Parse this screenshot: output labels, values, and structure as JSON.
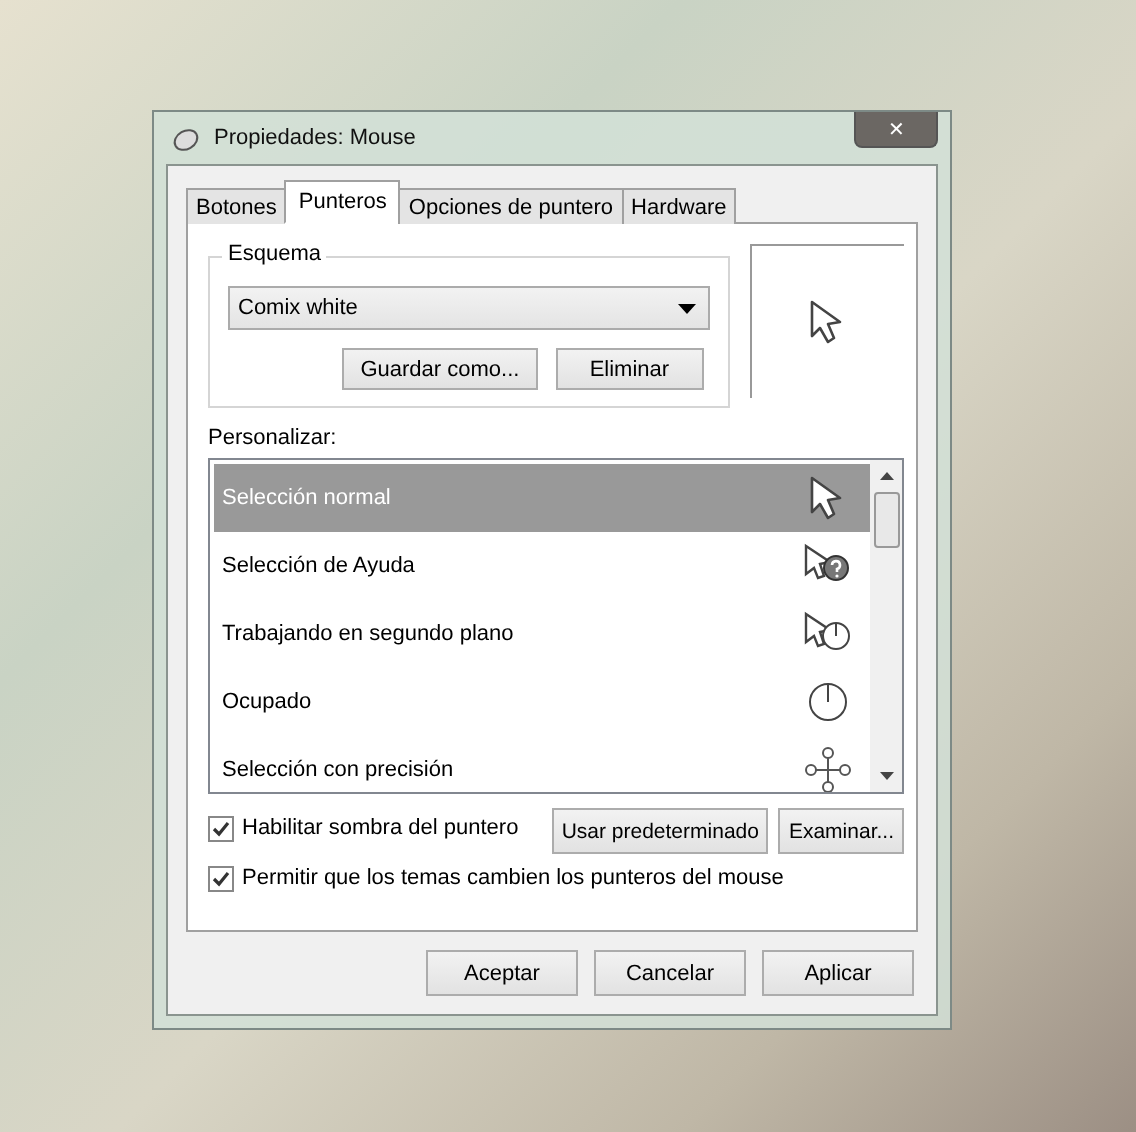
{
  "window": {
    "title": "Propiedades: Mouse",
    "close": "✕"
  },
  "tabs": [
    {
      "label": "Botones",
      "selected": false
    },
    {
      "label": "Punteros",
      "selected": true
    },
    {
      "label": "Opciones de puntero",
      "selected": false
    },
    {
      "label": "Hardware",
      "selected": false
    }
  ],
  "scheme": {
    "legend": "Esquema",
    "value": "Comix white",
    "buttons": [
      "Guardar como...",
      "Eliminar"
    ]
  },
  "customize": {
    "label": "Personalizar:",
    "items": [
      {
        "label": "Selección normal",
        "kind": "arrow",
        "selected": true
      },
      {
        "label": "Selección de Ayuda",
        "kind": "help",
        "selected": false
      },
      {
        "label": "Trabajando en segundo plano",
        "kind": "working",
        "selected": false
      },
      {
        "label": "Ocupado",
        "kind": "busy",
        "selected": false
      },
      {
        "label": "Selección con precisión",
        "kind": "precision",
        "selected": false
      }
    ]
  },
  "options": [
    {
      "label": "Habilitar sombra del puntero",
      "checked": true
    },
    {
      "label": "Permitir que los temas cambien los punteros del mouse",
      "checked": true
    }
  ],
  "side_buttons": [
    "Usar predeterminado",
    "Examinar..."
  ],
  "footer_buttons": [
    "Aceptar",
    "Cancelar",
    "Aplicar"
  ]
}
